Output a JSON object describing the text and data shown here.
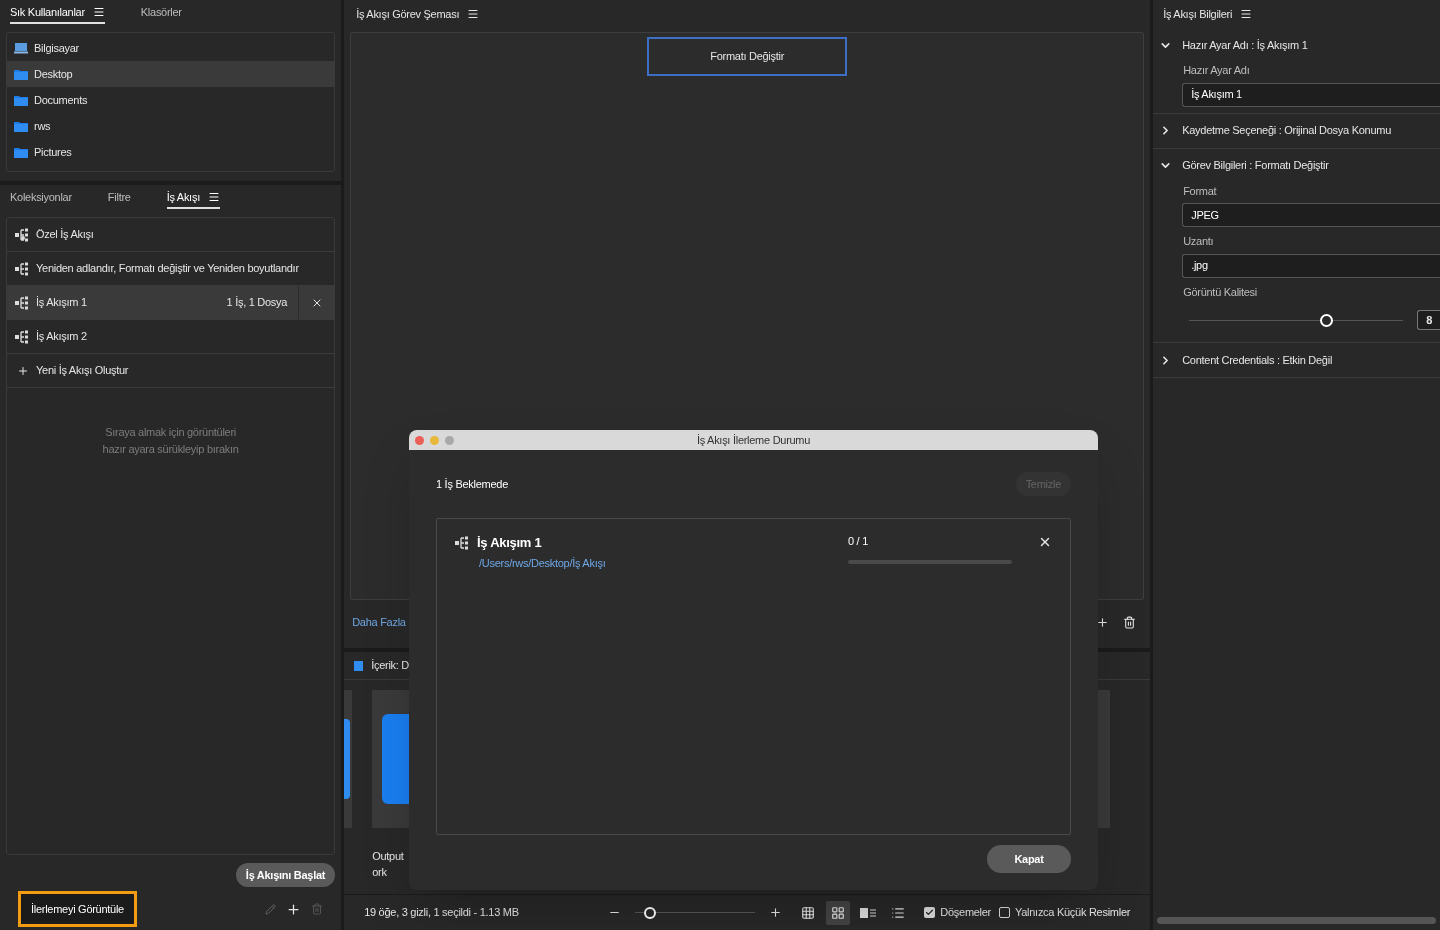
{
  "favorites_panel": {
    "tabs": [
      {
        "label": "Sık Kullanılanlar",
        "selected": true,
        "has_menu": true
      },
      {
        "label": "Klasörler",
        "selected": false,
        "has_menu": false
      }
    ],
    "items": [
      {
        "label": "Bilgisayar",
        "kind": "computer",
        "selected": false
      },
      {
        "label": "Desktop",
        "kind": "folder",
        "selected": true
      },
      {
        "label": "Documents",
        "kind": "folder",
        "selected": false
      },
      {
        "label": "rws",
        "kind": "folder",
        "selected": false
      },
      {
        "label": "Pictures",
        "kind": "folder",
        "selected": false
      }
    ]
  },
  "workflow_panel": {
    "tabs": [
      {
        "label": "Koleksiyonlar",
        "selected": false,
        "has_menu": false
      },
      {
        "label": "Filtre",
        "selected": false,
        "has_menu": false
      },
      {
        "label": "İş Akışı",
        "selected": true,
        "has_menu": true
      }
    ],
    "items": [
      {
        "label": "Özel İş Akışı",
        "kind": "custom",
        "selected": false
      },
      {
        "label": "Yeniden adlandır, Formatı değiştir ve Yeniden boyutlandır",
        "kind": "workflow",
        "selected": false
      },
      {
        "label": "İş Akışım 1",
        "kind": "workflow",
        "selected": true,
        "count": "1 İş, 1 Dosya"
      },
      {
        "label": "İş Akışım 2",
        "kind": "workflow",
        "selected": false
      },
      {
        "label": "Yeni İş Akışı Oluştur",
        "kind": "new",
        "selected": false
      }
    ],
    "drop_hint": [
      "Sıraya almak için görüntüleri",
      "hazır ayara sürükleyip bırakın"
    ],
    "start_button": "İş Akışını Başlat",
    "view_progress_button": {
      "label": "İlerlemeyi Görüntüle",
      "highlighted": true
    }
  },
  "task_chart": {
    "title": "İş Akışı Görev Şeması",
    "tasks": [
      {
        "label": "Formatı Değiştir",
        "selected": true
      }
    ],
    "more_link": "Daha Fazla"
  },
  "content_panel": {
    "title": "İçerik: D",
    "caption_lines": [
      "Output",
      "ork"
    ]
  },
  "status_bar": {
    "summary": "19 öğe, 3 gizli, 1 seçildi - 1.13 MB",
    "zoom_slider": {
      "level": 0.12
    },
    "view_modes": [
      {
        "kind": "grid",
        "selected": false
      },
      {
        "kind": "tiles",
        "selected": true
      },
      {
        "kind": "details",
        "selected": false
      },
      {
        "kind": "list",
        "selected": false
      }
    ],
    "options": [
      {
        "label": "Döşemeler",
        "checked": true
      },
      {
        "label": "Yalnızca Küçük Resimler",
        "checked": false
      }
    ]
  },
  "info_panel": {
    "title": "İş Akışı Bilgileri",
    "sections": [
      {
        "title": "Hazır Ayar Adı : İş Akışım 1",
        "expanded": true,
        "fields": [
          {
            "kind": "text",
            "label": "Hazır Ayar Adı",
            "value": "İş Akışım 1"
          }
        ]
      },
      {
        "title": "Kaydetme Seçeneği : Orijinal Dosya Konumu",
        "expanded": false
      },
      {
        "title": "Görev Bilgileri : Formatı Değiştir",
        "expanded": true,
        "fields": [
          {
            "kind": "text",
            "label": "Format",
            "value": "JPEG"
          },
          {
            "kind": "text",
            "label": "Uzantı",
            "value": ".jpg"
          },
          {
            "kind": "slider",
            "label": "Görüntü Kalitesi",
            "level": 0.64,
            "value": "8"
          }
        ]
      },
      {
        "title": "Content Credentials : Etkin Değil",
        "expanded": false
      }
    ]
  },
  "progress_dialog": {
    "title": "İş Akışı İlerleme Durumu",
    "pending": "1 İş Beklemede",
    "clear_button": {
      "label": "Temizle",
      "disabled": true
    },
    "jobs": [
      {
        "name": "İş Akışım 1",
        "path": "/Users/rws/Desktop/İş Akışı",
        "progress": "0 / 1",
        "level": 0
      }
    ],
    "close_button": "Kapat"
  }
}
